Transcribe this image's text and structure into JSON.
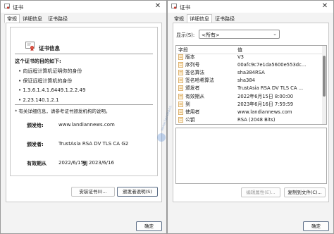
{
  "left": {
    "title": "证书",
    "tabs": [
      "常规",
      "详细信息",
      "证书路径"
    ],
    "cert_info_title": "证书信息",
    "purpose_heading": "这个证书的目的如下:",
    "purposes": [
      "• 向远程计算机证明你的身份",
      "• 保证远程计算机的身份",
      "• 1.3.6.1.4.1.6449.1.2.2.49",
      "• 2.23.140.1.2.1"
    ],
    "note": "* 有关详细信息，请参考证书颁发机构的说明。",
    "issued_to_label": "颁发给:",
    "issued_to_value": "www.landiannews.com",
    "issued_by_label": "颁发者:",
    "issued_by_value": "TrustAsia RSA DV TLS CA G2",
    "validity_label": "有效期从",
    "validity_from": "2022/6/15",
    "validity_to_word": "到",
    "validity_to": "2023/6/16",
    "install_button": "安装证书(I)...",
    "issuer_statement_button": "颁发者说明(S)",
    "ok_button": "确定"
  },
  "right": {
    "title": "证书",
    "tabs": [
      "常规",
      "详细信息",
      "证书路径"
    ],
    "show_label": "显示(S):",
    "show_value": "<所有>",
    "col_field": "字段",
    "col_value": "值",
    "rows": [
      {
        "field": "版本",
        "value": "V3"
      },
      {
        "field": "序列号",
        "value": "00afc9c7e1da5600e553dc..."
      },
      {
        "field": "签名算法",
        "value": "sha384RSA"
      },
      {
        "field": "签名哈希算法",
        "value": "sha384"
      },
      {
        "field": "颁发者",
        "value": "TrustAsia RSA DV TLS CA ..."
      },
      {
        "field": "有效期从",
        "value": "2022年6月15日 8:00:00"
      },
      {
        "field": "到",
        "value": "2023年6月16日 7:59:59"
      },
      {
        "field": "使用者",
        "value": "www.landiannews.com"
      },
      {
        "field": "公钥",
        "value": "RSA (2048 Bits)"
      }
    ],
    "edit_properties_button": "编辑属性(E)...",
    "copy_to_file_button": "复制到文件(C)...",
    "ok_button": "确定"
  },
  "colors": {
    "accent": "#0067c0",
    "cert_ribbon": "#c53a2f",
    "field_icon": "#e2b66c"
  }
}
